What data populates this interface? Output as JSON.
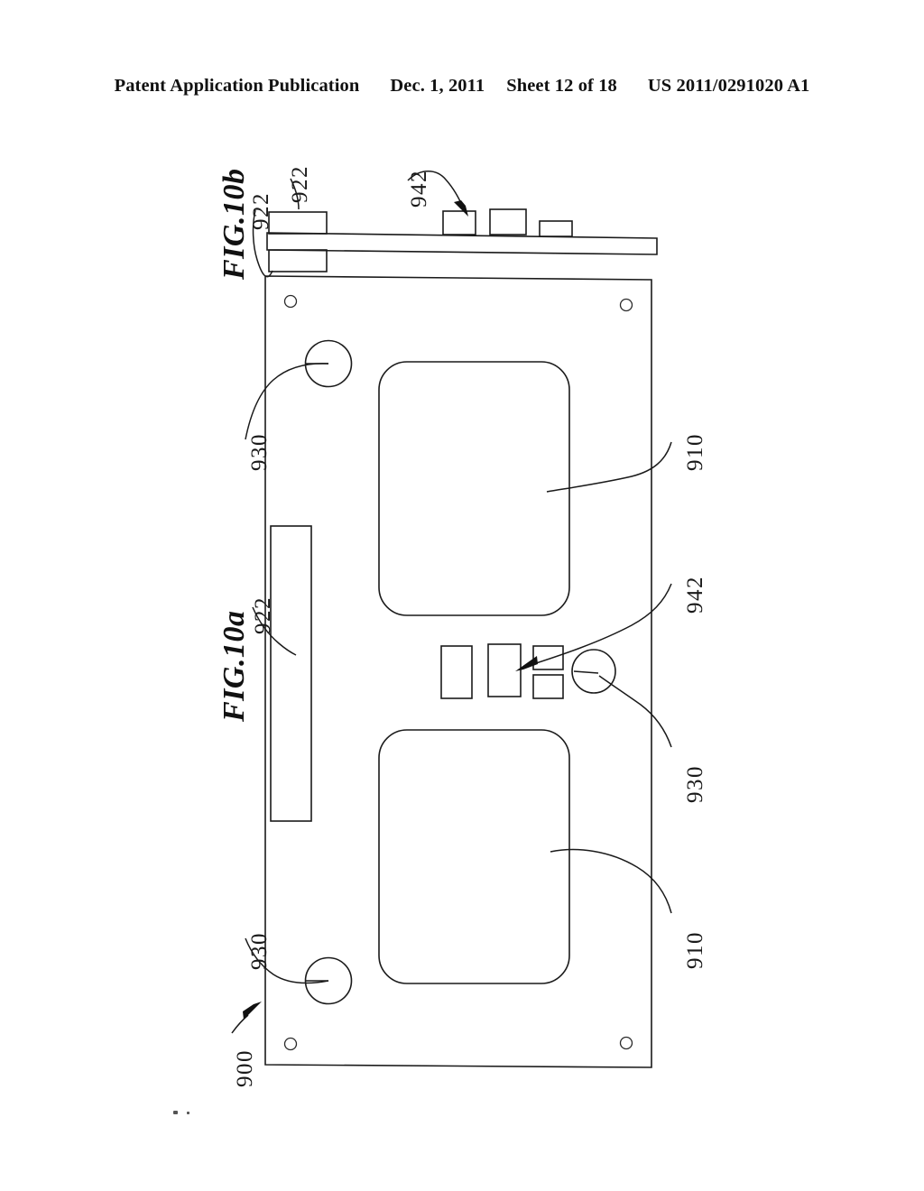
{
  "header": {
    "publication": "Patent Application Publication",
    "date": "Dec. 1, 2011",
    "sheet": "Sheet 12 of 18",
    "patent_number": "US 2011/0291020 A1"
  },
  "figures": [
    {
      "id": "fig-10b",
      "label": "FIG.10b",
      "view": "side elevation"
    },
    {
      "id": "fig-10a",
      "label": "FIG.10a",
      "view": "plan"
    }
  ],
  "reference_numerals": {
    "fig10b_922_upper": "922",
    "fig10b_922_lower": "922",
    "fig10b_942": "942",
    "fig10a_922": "922",
    "fig10a_930_top": "930",
    "fig10a_930_bottom": "930",
    "fig10a_930_right": "930",
    "fig10a_910_top": "910",
    "fig10a_910_bottom": "910",
    "fig10a_942": "942",
    "fig10a_900": "900"
  },
  "colors": {
    "ink": "#1a1a1a",
    "paper": "#ffffff"
  }
}
